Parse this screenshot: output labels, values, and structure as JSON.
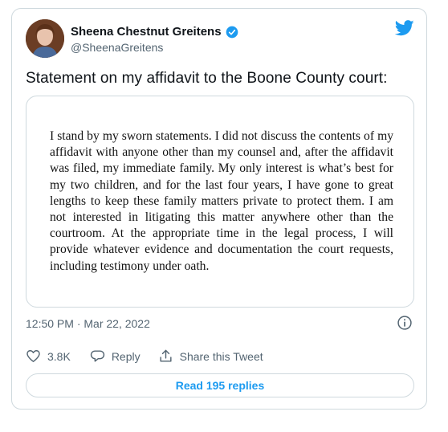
{
  "author": {
    "name": "Sheena Chestnut Greitens",
    "handle": "@SheenaGreitens"
  },
  "tweet": {
    "text": "Statement on my affidavit to the Boone County court:",
    "statement": "I stand by my sworn statements. I did not discuss the contents of my affidavit with anyone other than my counsel and, after the affidavit was filed, my immediate family.  My only interest is what’s best for my two children, and for the last four years, I have gone to great lengths to keep these family matters private to protect them. I am not interested in litigating this matter anywhere other than the courtroom. At the appropriate time in the legal process, I will provide whatever evidence and documentation the court requests, including testimony under oath.",
    "timestamp": "12:50 PM · Mar 22, 2022"
  },
  "actions": {
    "likes": "3.8K",
    "reply_label": "Reply",
    "share_label": "Share this Tweet"
  },
  "read_replies_label": "Read 195 replies",
  "icons": {
    "brand": "twitter-bird-icon",
    "verified": "verified-badge-icon",
    "info": "info-icon",
    "like": "heart-icon",
    "reply": "reply-bubble-icon",
    "share": "share-icon"
  },
  "colors": {
    "accent": "#1d9bf0",
    "text": "#0f1419",
    "muted": "#536471",
    "border": "#cfd9de"
  }
}
